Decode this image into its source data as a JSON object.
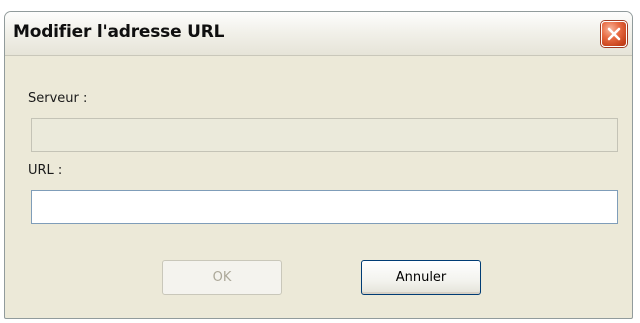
{
  "window": {
    "title": "Modifier l'adresse URL"
  },
  "icons": {
    "close": "close-icon"
  },
  "form": {
    "server_label": "Serveur :",
    "server_value": "",
    "url_label": "URL :",
    "url_value": ""
  },
  "buttons": {
    "ok_label": "OK",
    "cancel_label": "Annuler"
  },
  "colors": {
    "dialog_background": "#ece9d8",
    "close_button": "#e86c44",
    "default_button_border": "#003c74",
    "disabled_text": "#aca899"
  }
}
